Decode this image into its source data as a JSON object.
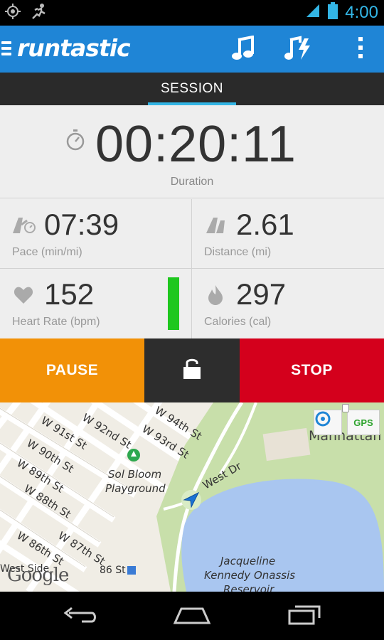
{
  "status_bar": {
    "time": "4:00",
    "icons": [
      "gps-icon",
      "runner-icon",
      "signal-icon",
      "battery-icon"
    ]
  },
  "action_bar": {
    "app_name": "runtastic",
    "actions": [
      "music-icon",
      "powersong-icon",
      "overflow-menu-icon"
    ],
    "color": "#1f85d6"
  },
  "tabs": [
    {
      "label": "SESSION",
      "selected": true
    }
  ],
  "session": {
    "duration": {
      "value": "00:20:11",
      "label": "Duration"
    },
    "pace": {
      "value": "07:39",
      "label": "Pace (min/mi)"
    },
    "distance": {
      "value": "2.61",
      "label": "Distance (mi)"
    },
    "heart_rate": {
      "value": "152",
      "label": "Heart Rate (bpm)",
      "zone_color": "#1ec71e"
    },
    "calories": {
      "value": "297",
      "label": "Calories (cal)"
    }
  },
  "controls": {
    "pause_label": "PAUSE",
    "stop_label": "STOP",
    "pause_color": "#f29107",
    "stop_color": "#d4001c",
    "lock_color": "#2d2d2d"
  },
  "map": {
    "streets": [
      "W 94th St",
      "W 93rd St",
      "W 92nd St",
      "W 91st St",
      "W 90th St",
      "W 89th St",
      "W 88th St",
      "W 87th St",
      "W 86th St",
      "West Dr"
    ],
    "places": [
      "Sol Bloom Playground",
      "Manhattan",
      "Jacqueline Kennedy Onassis Reservoir",
      "West Side",
      "86 St"
    ],
    "sol_bloom_line1": "Sol Bloom",
    "sol_bloom_line2": "Playground",
    "reservoir_line1": "Jacqueline",
    "reservoir_line2": "Kennedy Onassis",
    "reservoir_line3": "Reservoir",
    "gps_label": "GPS",
    "attribution": "Google",
    "park_color": "#c8dfaa",
    "water_color": "#a9c6f0"
  },
  "nav_bar": [
    "back-icon",
    "home-icon",
    "recent-apps-icon"
  ]
}
